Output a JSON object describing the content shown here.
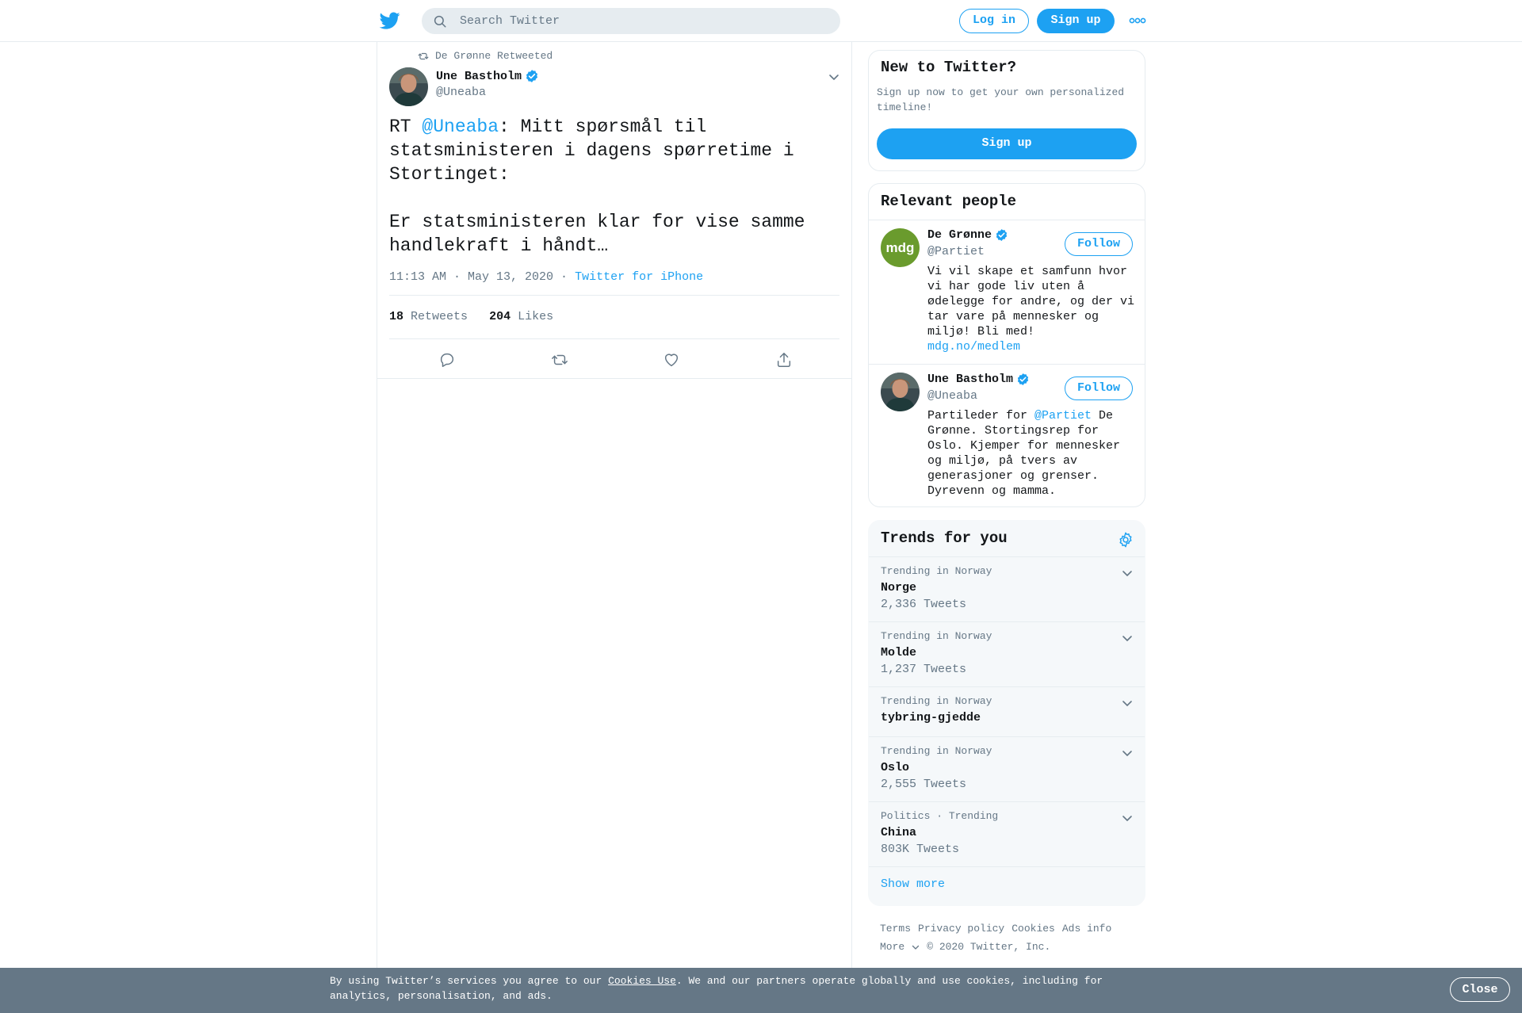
{
  "header": {
    "search_placeholder": "Search Twitter",
    "login_label": "Log in",
    "signup_label": "Sign up"
  },
  "tweet": {
    "retweeted_by": "De Grønne Retweeted",
    "author_name": "Une Bastholm",
    "author_handle": "@Uneaba",
    "text_prefix": "RT ",
    "text_mention": "@Uneaba",
    "text_body": ": Mitt spørsmål til\nstatsministeren i dagens spørretime i\nStortinget:\n\nEr statsministeren klar for vise samme\nhandlekraft i håndt…",
    "timestamp": "11:13 AM · May 13, 2020",
    "source_sep": " · ",
    "source": "Twitter for iPhone",
    "retweets_count": "18",
    "retweets_label": "Retweets",
    "likes_count": "204",
    "likes_label": "Likes"
  },
  "new_to_twitter": {
    "title": "New to Twitter?",
    "description": "Sign up now to get your own personalized timeline!",
    "signup_label": "Sign up"
  },
  "relevant_people": {
    "title": "Relevant people",
    "people": [
      {
        "name": "De Grønne",
        "handle": "@Partiet",
        "avatar_text": "mdg",
        "follow_label": "Follow",
        "bio": "Vi vil skape et samfunn hvor vi har gode liv uten å ødelegge for andre, og der vi tar vare på mennesker og miljø! Bli med!",
        "link": "mdg.no/medlem"
      },
      {
        "name": "Une Bastholm",
        "handle": "@Uneaba",
        "follow_label": "Follow",
        "bio_prefix": "Partileder for ",
        "bio_mention": "@Partiet",
        "bio_suffix": " De Grønne. Stortingsrep for Oslo. Kjemper for mennesker og miljø, på tvers av generasjoner og grenser. Dyrevenn og mamma."
      }
    ]
  },
  "trends": {
    "title": "Trends for you",
    "items": [
      {
        "context": "Trending in Norway",
        "name": "Norge",
        "count": "2,336 Tweets"
      },
      {
        "context": "Trending in Norway",
        "name": "Molde",
        "count": "1,237 Tweets"
      },
      {
        "context": "Trending in Norway",
        "name": "tybring-gjedde",
        "count": ""
      },
      {
        "context": "Trending in Norway",
        "name": "Oslo",
        "count": "2,555 Tweets"
      },
      {
        "context": "Politics · Trending",
        "name": "China",
        "count": "803K Tweets"
      }
    ],
    "show_more": "Show more"
  },
  "footer": {
    "links": [
      "Terms",
      "Privacy policy",
      "Cookies",
      "Ads info"
    ],
    "more": "More",
    "copyright": "© 2020 Twitter, Inc."
  },
  "cookie_bar": {
    "text_before": "By using Twitter’s services you agree to our ",
    "link": "Cookies Use",
    "text_after": ". We and our partners operate globally and use cookies, including for analytics, personalisation, and ads.",
    "close_label": "Close"
  },
  "colors": {
    "accent": "#1da1f2",
    "verified": "#1da1f2",
    "mdg_green": "#6a9b2d",
    "cookie_bg": "#657786"
  }
}
